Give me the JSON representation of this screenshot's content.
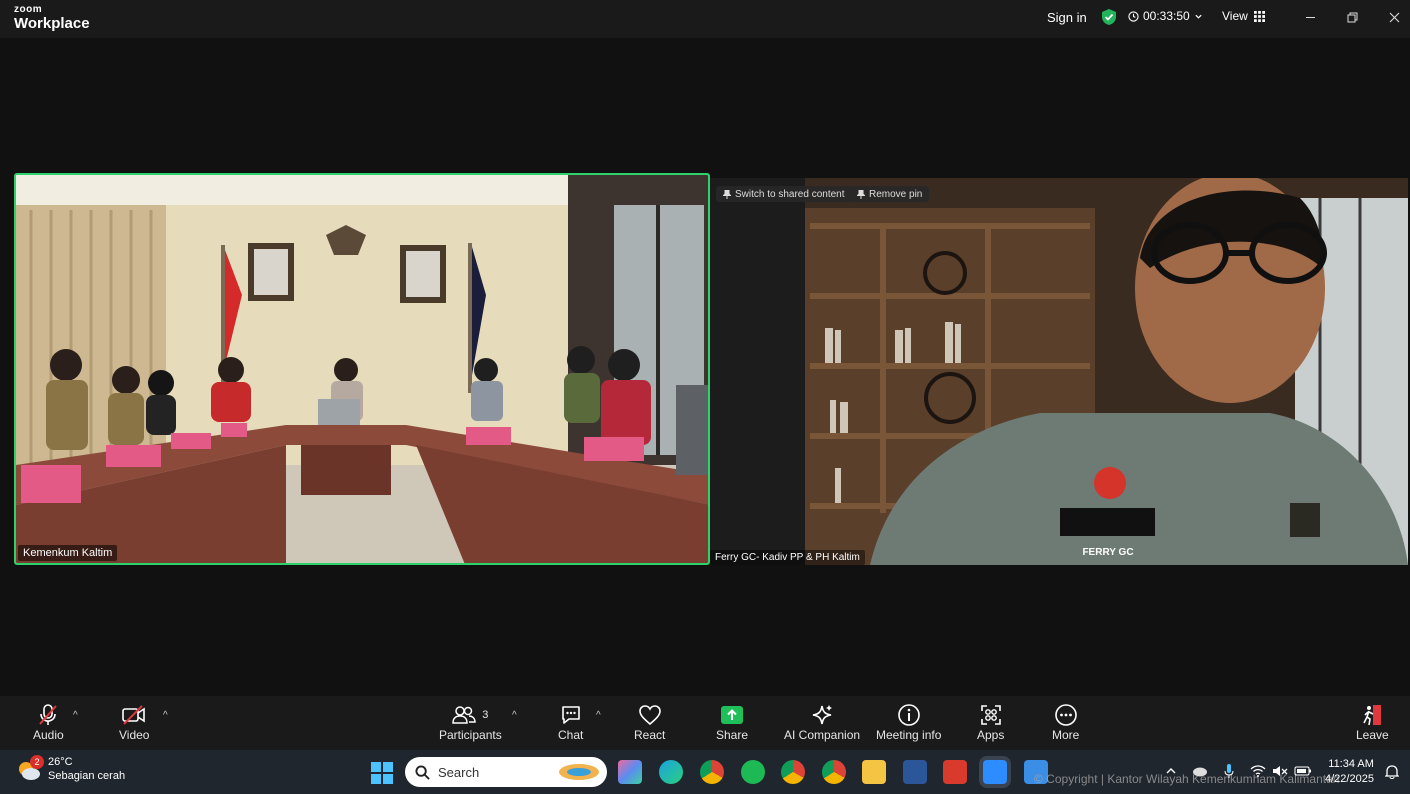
{
  "app": {
    "logo_line1": "zoom",
    "logo_line2": "Workplace",
    "sign_in": "Sign in",
    "timer": "00:33:50",
    "view": "View"
  },
  "participants_tiles": [
    {
      "name": "Kemenkum Kaltim"
    },
    {
      "name": "Ferry GC- Kadiv PP & PH Kaltim",
      "badge": "FERRY GC"
    }
  ],
  "pin_controls": {
    "switch_label": "Switch to shared content",
    "remove_pin_label": "Remove pin"
  },
  "toolbar": {
    "audio": "Audio",
    "video": "Video",
    "participants": "Participants",
    "participants_count": "3",
    "chat": "Chat",
    "react": "React",
    "share": "Share",
    "ai_companion": "AI Companion",
    "meeting_info": "Meeting info",
    "apps": "Apps",
    "more": "More",
    "leave": "Leave"
  },
  "taskbar": {
    "weather_temp": "26°C",
    "weather_desc": "Sebagian cerah",
    "weather_badge": "2",
    "search_placeholder": "Search",
    "time": "11:34 AM",
    "date": "4/22/2025",
    "copyright": "© Copyright | Kantor Wilayah Kemenkumham Kalimantan"
  },
  "colors": {
    "active_speaker": "#2bd36a",
    "share_green": "#1fbf5a",
    "leave_red": "#e0383e"
  }
}
